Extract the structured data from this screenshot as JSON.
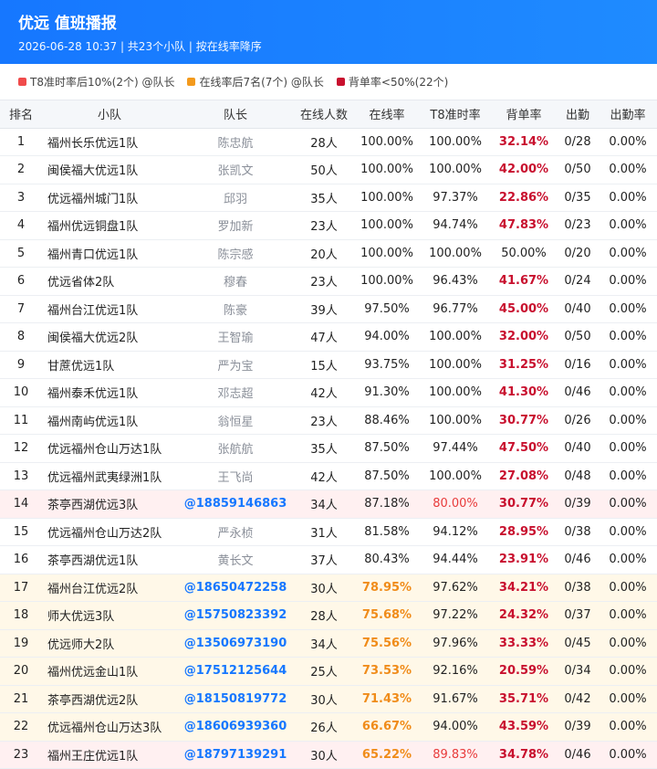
{
  "header": {
    "title": "优远 值班播报",
    "subtitle": "2026-06-28 10:37 | 共23个小队 | 按在线率降序"
  },
  "legend": [
    {
      "color": "#f04b4b",
      "text": "T8准时率后10%(2个) @队长"
    },
    {
      "color": "#f39a1d",
      "text": "在线率后7名(7个) @队长"
    },
    {
      "color": "#c8102e",
      "text": "背单率<50%(22个)"
    }
  ],
  "columns": [
    "排名",
    "小队",
    "队长",
    "在线人数",
    "在线率",
    "T8准时率",
    "背单率",
    "出勤",
    "出勤率"
  ],
  "rows": [
    {
      "rank": "1",
      "team": "福州长乐优远1队",
      "captain": "陈忠航",
      "captain_at": false,
      "count": "28人",
      "online": "100.00%",
      "online_low": false,
      "ontime": "100.00%",
      "ontime_bad": false,
      "back": "32.14%",
      "back_bad": true,
      "attend": "0/28",
      "attend_rate": "0.00%",
      "row_style": "white"
    },
    {
      "rank": "2",
      "team": "闽侯福大优远1队",
      "captain": "张凯文",
      "captain_at": false,
      "count": "50人",
      "online": "100.00%",
      "online_low": false,
      "ontime": "100.00%",
      "ontime_bad": false,
      "back": "42.00%",
      "back_bad": true,
      "attend": "0/50",
      "attend_rate": "0.00%",
      "row_style": "white"
    },
    {
      "rank": "3",
      "team": "优远福州城门1队",
      "captain": "邱羽",
      "captain_at": false,
      "count": "35人",
      "online": "100.00%",
      "online_low": false,
      "ontime": "97.37%",
      "ontime_bad": false,
      "back": "22.86%",
      "back_bad": true,
      "attend": "0/35",
      "attend_rate": "0.00%",
      "row_style": "white"
    },
    {
      "rank": "4",
      "team": "福州优远铜盘1队",
      "captain": "罗加新",
      "captain_at": false,
      "count": "23人",
      "online": "100.00%",
      "online_low": false,
      "ontime": "94.74%",
      "ontime_bad": false,
      "back": "47.83%",
      "back_bad": true,
      "attend": "0/23",
      "attend_rate": "0.00%",
      "row_style": "white"
    },
    {
      "rank": "5",
      "team": "福州青口优远1队",
      "captain": "陈宗感",
      "captain_at": false,
      "count": "20人",
      "online": "100.00%",
      "online_low": false,
      "ontime": "100.00%",
      "ontime_bad": false,
      "back": "50.00%",
      "back_bad": false,
      "attend": "0/20",
      "attend_rate": "0.00%",
      "row_style": "white"
    },
    {
      "rank": "6",
      "team": "优远省体2队",
      "captain": "穆春",
      "captain_at": false,
      "count": "23人",
      "online": "100.00%",
      "online_low": false,
      "ontime": "96.43%",
      "ontime_bad": false,
      "back": "41.67%",
      "back_bad": true,
      "attend": "0/24",
      "attend_rate": "0.00%",
      "row_style": "white"
    },
    {
      "rank": "7",
      "team": "福州台江优远1队",
      "captain": "陈豪",
      "captain_at": false,
      "count": "39人",
      "online": "97.50%",
      "online_low": false,
      "ontime": "96.77%",
      "ontime_bad": false,
      "back": "45.00%",
      "back_bad": true,
      "attend": "0/40",
      "attend_rate": "0.00%",
      "row_style": "white"
    },
    {
      "rank": "8",
      "team": "闽侯福大优远2队",
      "captain": "王智瑜",
      "captain_at": false,
      "count": "47人",
      "online": "94.00%",
      "online_low": false,
      "ontime": "100.00%",
      "ontime_bad": false,
      "back": "32.00%",
      "back_bad": true,
      "attend": "0/50",
      "attend_rate": "0.00%",
      "row_style": "white"
    },
    {
      "rank": "9",
      "team": "甘蔗优远1队",
      "captain": "严为宝",
      "captain_at": false,
      "count": "15人",
      "online": "93.75%",
      "online_low": false,
      "ontime": "100.00%",
      "ontime_bad": false,
      "back": "31.25%",
      "back_bad": true,
      "attend": "0/16",
      "attend_rate": "0.00%",
      "row_style": "white"
    },
    {
      "rank": "10",
      "team": "福州泰禾优远1队",
      "captain": "邓志超",
      "captain_at": false,
      "count": "42人",
      "online": "91.30%",
      "online_low": false,
      "ontime": "100.00%",
      "ontime_bad": false,
      "back": "41.30%",
      "back_bad": true,
      "attend": "0/46",
      "attend_rate": "0.00%",
      "row_style": "white"
    },
    {
      "rank": "11",
      "team": "福州南屿优远1队",
      "captain": "翁恒星",
      "captain_at": false,
      "count": "23人",
      "online": "88.46%",
      "online_low": false,
      "ontime": "100.00%",
      "ontime_bad": false,
      "back": "30.77%",
      "back_bad": true,
      "attend": "0/26",
      "attend_rate": "0.00%",
      "row_style": "white"
    },
    {
      "rank": "12",
      "team": "优远福州仓山万达1队",
      "captain": "张航航",
      "captain_at": false,
      "count": "35人",
      "online": "87.50%",
      "online_low": false,
      "ontime": "97.44%",
      "ontime_bad": false,
      "back": "47.50%",
      "back_bad": true,
      "attend": "0/40",
      "attend_rate": "0.00%",
      "row_style": "white"
    },
    {
      "rank": "13",
      "team": "优远福州武夷绿洲1队",
      "captain": "王飞尚",
      "captain_at": false,
      "count": "42人",
      "online": "87.50%",
      "online_low": false,
      "ontime": "100.00%",
      "ontime_bad": false,
      "back": "27.08%",
      "back_bad": true,
      "attend": "0/48",
      "attend_rate": "0.00%",
      "row_style": "white"
    },
    {
      "rank": "14",
      "team": "茶亭西湖优远3队",
      "captain": "@18859146863",
      "captain_at": true,
      "count": "34人",
      "online": "87.18%",
      "online_low": false,
      "ontime": "80.00%",
      "ontime_bad": true,
      "back": "30.77%",
      "back_bad": true,
      "attend": "0/39",
      "attend_rate": "0.00%",
      "row_style": "red"
    },
    {
      "rank": "15",
      "team": "优远福州仓山万达2队",
      "captain": "严永桢",
      "captain_at": false,
      "count": "31人",
      "online": "81.58%",
      "online_low": false,
      "ontime": "94.12%",
      "ontime_bad": false,
      "back": "28.95%",
      "back_bad": true,
      "attend": "0/38",
      "attend_rate": "0.00%",
      "row_style": "white"
    },
    {
      "rank": "16",
      "team": "茶亭西湖优远1队",
      "captain": "黄长文",
      "captain_at": false,
      "count": "37人",
      "online": "80.43%",
      "online_low": false,
      "ontime": "94.44%",
      "ontime_bad": false,
      "back": "23.91%",
      "back_bad": true,
      "attend": "0/46",
      "attend_rate": "0.00%",
      "row_style": "white"
    },
    {
      "rank": "17",
      "team": "福州台江优远2队",
      "captain": "@18650472258",
      "captain_at": true,
      "count": "30人",
      "online": "78.95%",
      "online_low": true,
      "ontime": "97.62%",
      "ontime_bad": false,
      "back": "34.21%",
      "back_bad": true,
      "attend": "0/38",
      "attend_rate": "0.00%",
      "row_style": "orange"
    },
    {
      "rank": "18",
      "team": "师大优远3队",
      "captain": "@15750823392",
      "captain_at": true,
      "count": "28人",
      "online": "75.68%",
      "online_low": true,
      "ontime": "97.22%",
      "ontime_bad": false,
      "back": "24.32%",
      "back_bad": true,
      "attend": "0/37",
      "attend_rate": "0.00%",
      "row_style": "orange"
    },
    {
      "rank": "19",
      "team": "优远师大2队",
      "captain": "@13506973190",
      "captain_at": true,
      "count": "34人",
      "online": "75.56%",
      "online_low": true,
      "ontime": "97.96%",
      "ontime_bad": false,
      "back": "33.33%",
      "back_bad": true,
      "attend": "0/45",
      "attend_rate": "0.00%",
      "row_style": "orange"
    },
    {
      "rank": "20",
      "team": "福州优远金山1队",
      "captain": "@17512125644",
      "captain_at": true,
      "count": "25人",
      "online": "73.53%",
      "online_low": true,
      "ontime": "92.16%",
      "ontime_bad": false,
      "back": "20.59%",
      "back_bad": true,
      "attend": "0/34",
      "attend_rate": "0.00%",
      "row_style": "orange"
    },
    {
      "rank": "21",
      "team": "茶亭西湖优远2队",
      "captain": "@18150819772",
      "captain_at": true,
      "count": "30人",
      "online": "71.43%",
      "online_low": true,
      "ontime": "91.67%",
      "ontime_bad": false,
      "back": "35.71%",
      "back_bad": true,
      "attend": "0/42",
      "attend_rate": "0.00%",
      "row_style": "orange"
    },
    {
      "rank": "22",
      "team": "优远福州仓山万达3队",
      "captain": "@18606939360",
      "captain_at": true,
      "count": "26人",
      "online": "66.67%",
      "online_low": true,
      "ontime": "94.00%",
      "ontime_bad": false,
      "back": "43.59%",
      "back_bad": true,
      "attend": "0/39",
      "attend_rate": "0.00%",
      "row_style": "orange"
    },
    {
      "rank": "23",
      "team": "福州王庄优远1队",
      "captain": "@18797139291",
      "captain_at": true,
      "count": "30人",
      "online": "65.22%",
      "online_low": true,
      "ontime": "89.83%",
      "ontime_bad": true,
      "back": "34.78%",
      "back_bad": true,
      "attend": "0/46",
      "attend_rate": "0.00%",
      "row_style": "red"
    }
  ]
}
